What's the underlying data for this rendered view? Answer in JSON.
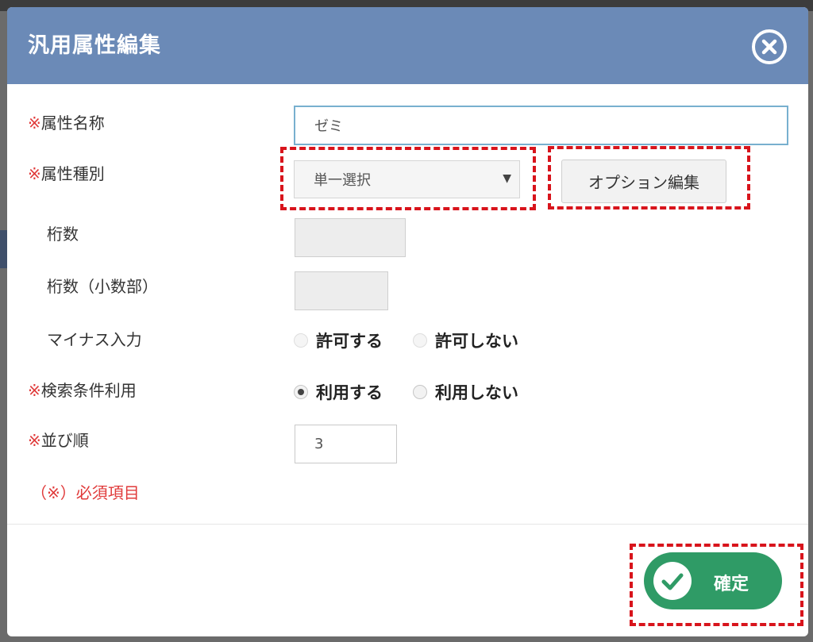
{
  "dialog": {
    "title": "汎用属性編集",
    "close_icon": "close-circle-icon"
  },
  "form": {
    "required_mark": "※",
    "attribute_name": {
      "label": "属性名称",
      "value": "ゼミ"
    },
    "attribute_type": {
      "label": "属性種別",
      "selected": "単一選択",
      "option_button": "オプション編集"
    },
    "digits": {
      "label": "桁数",
      "value": ""
    },
    "decimal_digits": {
      "label": "桁数（小数部）",
      "value": ""
    },
    "minus_input": {
      "label": "マイナス入力",
      "option_allow": "許可する",
      "option_deny": "許可しない"
    },
    "search_condition": {
      "label": "検索条件利用",
      "option_use": "利用する",
      "option_not_use": "利用しない",
      "selected": "利用する"
    },
    "sort_order": {
      "label": "並び順",
      "value": "3"
    },
    "required_note": "（※）必須項目"
  },
  "footer": {
    "confirm_label": "確定",
    "confirm_icon": "checkmark-icon"
  },
  "colors": {
    "header": "#6b8ab7",
    "required": "#e03a3a",
    "confirm": "#2f9b66",
    "highlight": "#d8141c"
  }
}
